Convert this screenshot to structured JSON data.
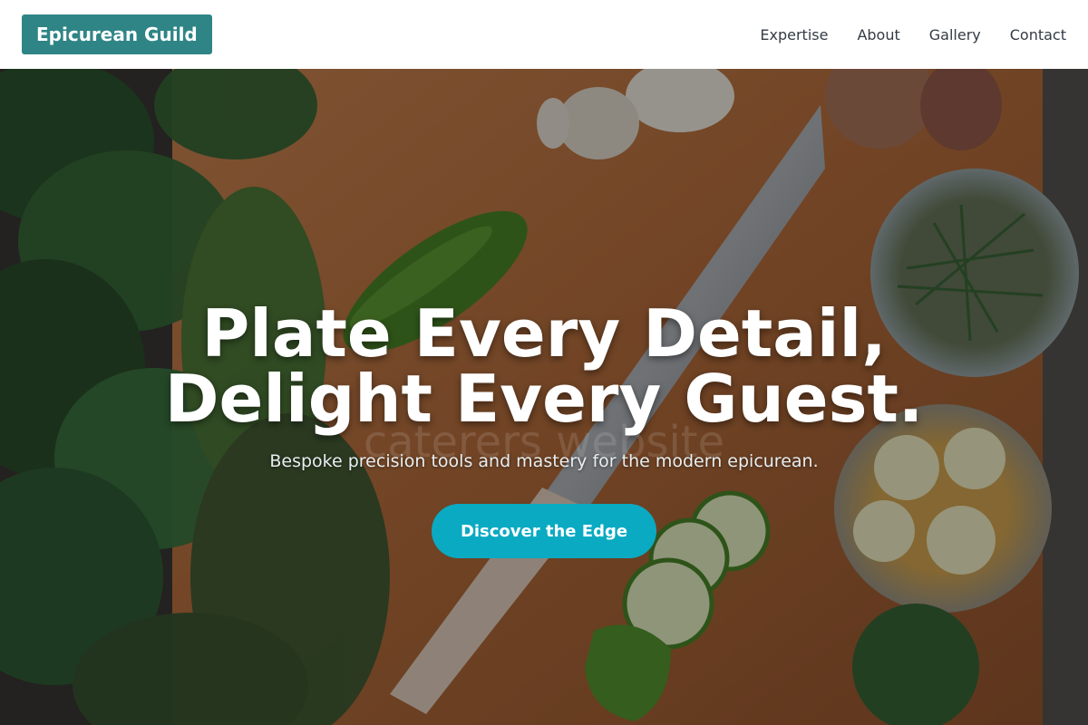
{
  "nav": {
    "brand": "Epicurean Guild",
    "links": [
      "Expertise",
      "About",
      "Gallery",
      "Contact"
    ]
  },
  "hero": {
    "headline_line1": "Plate Every Detail,",
    "headline_line2": "Delight Every Guest.",
    "watermark": "caterers website",
    "subtitle": "Bespoke precision tools and mastery for the modern epicurean.",
    "cta": "Discover the Edge"
  },
  "colors": {
    "brand_bg": "#2f8585",
    "cta_bg": "#0aaac2",
    "nav_text": "#333b45"
  }
}
